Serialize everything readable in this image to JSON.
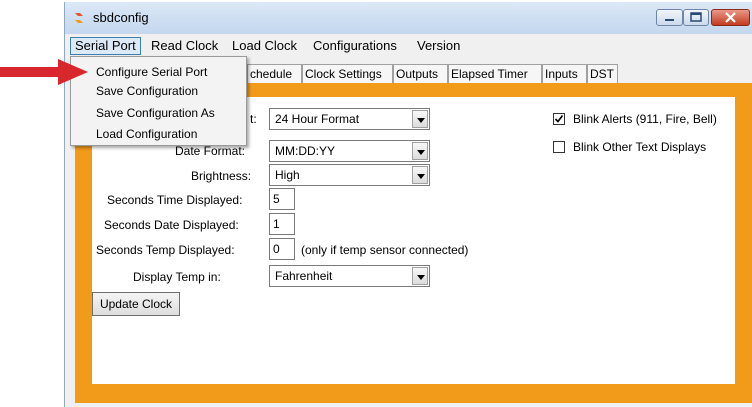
{
  "window": {
    "title": "sbdconfig"
  },
  "menubar": {
    "items": [
      "Serial Port",
      "Read Clock",
      "Load Clock",
      "Configurations",
      "Version"
    ]
  },
  "dropdown": {
    "items": [
      "Configure Serial Port",
      "Save Configuration",
      "Save Configuration As",
      "Load Configuration"
    ]
  },
  "tabs": [
    "chedule",
    "Clock Settings",
    "Outputs",
    "Elapsed Timer",
    "Inputs",
    "DST"
  ],
  "settings": {
    "time_format_label_partial": "t:",
    "time_format_value": "24 Hour Format",
    "date_format_label_partial": "Date Format:",
    "date_format_value": "MM:DD:YY",
    "brightness_label": "Brightness:",
    "brightness_value": "High",
    "seconds_time_label": "Seconds Time Displayed:",
    "seconds_time_value": "5",
    "seconds_date_label": "Seconds Date Displayed:",
    "seconds_date_value": "1",
    "seconds_temp_label": "Seconds Temp Displayed:",
    "seconds_temp_value": "0",
    "seconds_temp_note": "(only if temp sensor connected)",
    "display_temp_label": "Display Temp in:",
    "display_temp_value": "Fahrenheit",
    "blink_alerts_label": "Blink Alerts (911, Fire, Bell)",
    "blink_alerts_checked": true,
    "blink_other_label": "Blink Other Text Displays",
    "blink_other_checked": false,
    "update_button": "Update Clock"
  },
  "colors": {
    "panel_orange": "#f29a1a",
    "arrow_red": "#d9272e"
  }
}
